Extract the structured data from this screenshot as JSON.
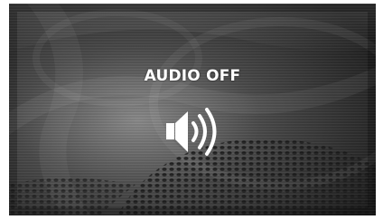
{
  "overlay": {
    "title": "AUDIO OFF",
    "icon": "speaker-icon"
  },
  "colors": {
    "text": "#ffffff",
    "background": "#3a3a3a",
    "icon_fill": "#ffffff"
  }
}
